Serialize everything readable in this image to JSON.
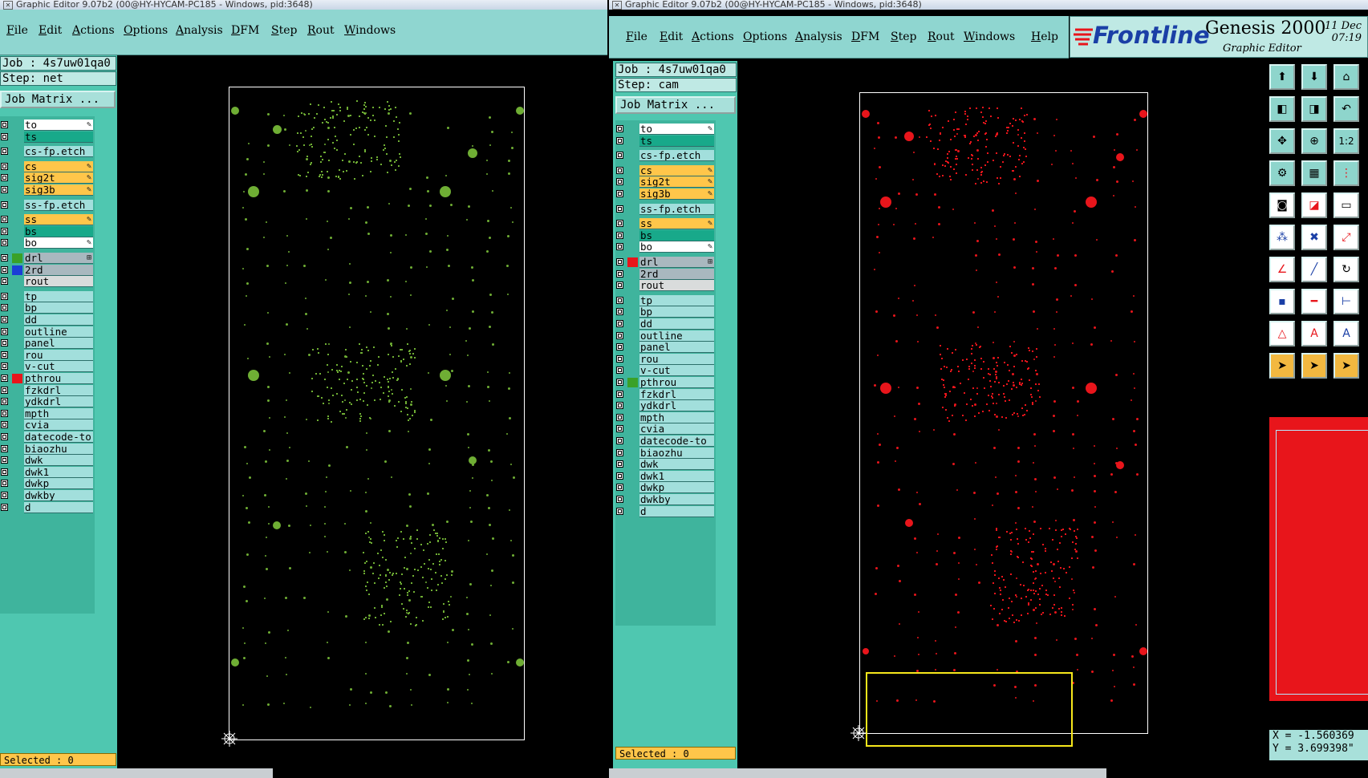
{
  "left": {
    "title": "Graphic Editor 9.07b2 (00@HY-HYCAM-PC185 - Windows, pid:3648)",
    "menus": [
      "File",
      "Edit",
      "Actions",
      "Options",
      "Analysis",
      "DFM",
      "Step",
      "Rout",
      "Windows"
    ],
    "job_line": "Job : 4s7uw01qa0",
    "step_line": "Step: net",
    "job_matrix": "Job Matrix ...",
    "selected": "Selected : 0",
    "board_color": "#6fae34"
  },
  "right": {
    "title": "Graphic Editor 9.07b2 (00@HY-HYCAM-PC185 - Windows, pid:3648)",
    "menus": [
      "File",
      "Edit",
      "Actions",
      "Options",
      "Analysis",
      "DFM",
      "Step",
      "Rout",
      "Windows",
      "Help"
    ],
    "job_line": "Job : 4s7uw01qa0",
    "step_line": "Step: cam",
    "job_matrix": "Job Matrix ...",
    "selected": "Selected : 0",
    "board_color": "#e8151b",
    "highlight_color": "#f7e71b"
  },
  "brand": {
    "logo": "Frontline",
    "product": "Genesis 2000",
    "subtitle": "Graphic Editor",
    "date": "11 Dec",
    "time": "07:19"
  },
  "coordinates": {
    "x": "X = -1.560369",
    "y": "Y = 3.699398\""
  },
  "layers": [
    {
      "name": "to",
      "style": "white",
      "mark": "✎"
    },
    {
      "name": "ts",
      "style": "teal",
      "mark": ""
    },
    {
      "name": "cs-fp.etch",
      "style": "cyan",
      "mark": "",
      "gap": true
    },
    {
      "name": "cs",
      "style": "orange",
      "mark": "✎",
      "gap": true
    },
    {
      "name": "sig2t",
      "style": "orange",
      "mark": "✎"
    },
    {
      "name": "sig3b",
      "style": "orange",
      "mark": "✎"
    },
    {
      "name": "ss-fp.etch",
      "style": "cyan",
      "mark": "",
      "gap": true
    },
    {
      "name": "ss",
      "style": "orange",
      "mark": "✎",
      "gap": true
    },
    {
      "name": "bs",
      "style": "teal",
      "mark": ""
    },
    {
      "name": "bo",
      "style": "white",
      "mark": "✎"
    },
    {
      "name": "drl",
      "style": "grey",
      "mark": "⊞",
      "gap": true
    },
    {
      "name": "2rd",
      "style": "grey",
      "mark": ""
    },
    {
      "name": "rout",
      "style": "lgrey",
      "mark": ""
    },
    {
      "name": "tp",
      "style": "cyan",
      "mark": "",
      "gap": true
    },
    {
      "name": "bp",
      "style": "cyan",
      "mark": ""
    },
    {
      "name": "dd",
      "style": "cyan",
      "mark": ""
    },
    {
      "name": "outline",
      "style": "cyan",
      "mark": ""
    },
    {
      "name": "panel",
      "style": "cyan",
      "mark": ""
    },
    {
      "name": "rou",
      "style": "cyan",
      "mark": ""
    },
    {
      "name": "v-cut",
      "style": "cyan",
      "mark": ""
    },
    {
      "name": "pthrou",
      "style": "cyan",
      "mark": ""
    },
    {
      "name": "fzkdrl",
      "style": "cyan",
      "mark": ""
    },
    {
      "name": "ydkdrl",
      "style": "cyan",
      "mark": ""
    },
    {
      "name": "mpth",
      "style": "cyan",
      "mark": ""
    },
    {
      "name": "cvia",
      "style": "cyan",
      "mark": ""
    },
    {
      "name": "datecode-to",
      "style": "cyan",
      "mark": ""
    },
    {
      "name": "biaozhu",
      "style": "cyan",
      "mark": ""
    },
    {
      "name": "dwk",
      "style": "cyan",
      "mark": ""
    },
    {
      "name": "dwk1",
      "style": "cyan",
      "mark": ""
    },
    {
      "name": "dwkp",
      "style": "cyan",
      "mark": ""
    },
    {
      "name": "dwkby",
      "style": "cyan",
      "mark": ""
    },
    {
      "name": "d",
      "style": "cyan",
      "mark": ""
    }
  ]
}
